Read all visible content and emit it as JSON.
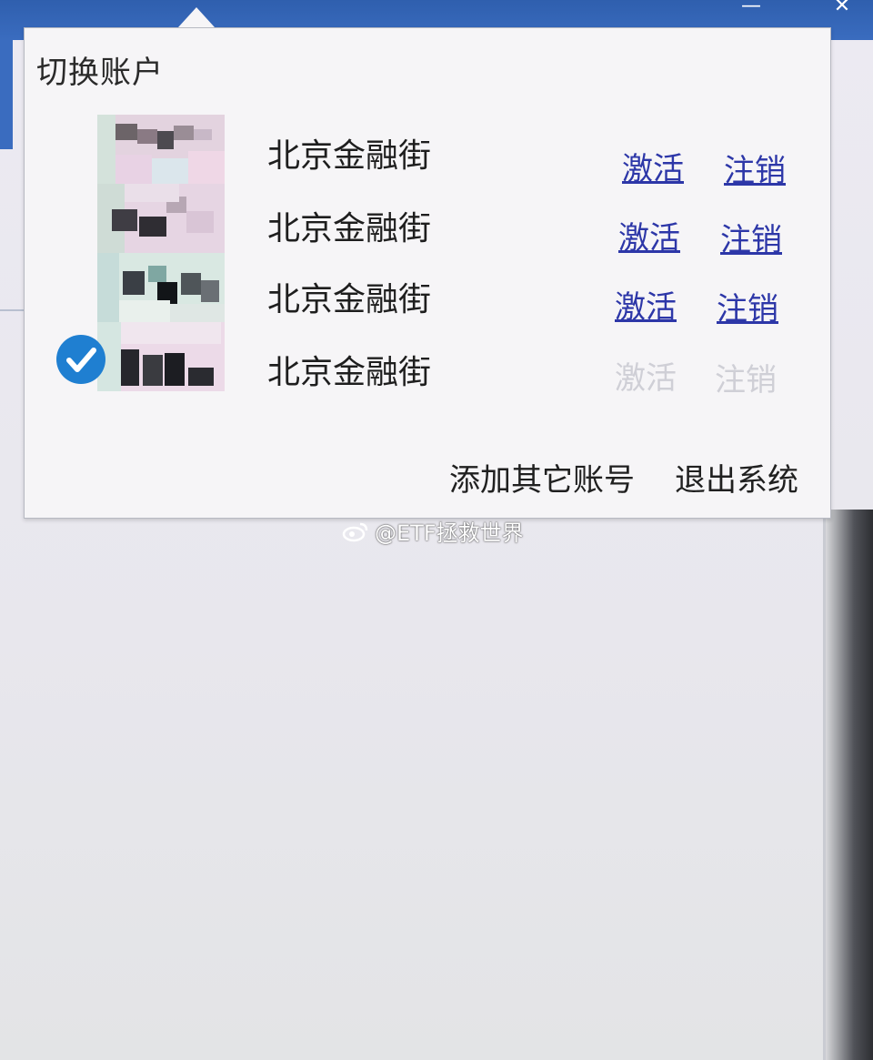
{
  "popup": {
    "title": "切换账户",
    "accounts": [
      {
        "name": "北京金融街",
        "activate": "激活",
        "logout": "注销",
        "enabled": true,
        "selected": false
      },
      {
        "name": "北京金融街",
        "activate": "激活",
        "logout": "注销",
        "enabled": true,
        "selected": false
      },
      {
        "name": "北京金融街",
        "activate": "激活",
        "logout": "注销",
        "enabled": true,
        "selected": false
      },
      {
        "name": "北京金融街",
        "activate": "激活",
        "logout": "注销",
        "enabled": false,
        "selected": true
      }
    ],
    "add_account_label": "添加其它账号",
    "exit_label": "退出系统"
  },
  "window": {
    "minimize_glyph": "—",
    "close_glyph": "✕"
  },
  "watermark": {
    "icon": "weibo-icon",
    "text": "@ETF拯救世界"
  },
  "colors": {
    "app_bar": "#3a6cbf",
    "link": "#2d37a8",
    "link_disabled": "#cfcfd6",
    "check": "#1f7fd1"
  }
}
